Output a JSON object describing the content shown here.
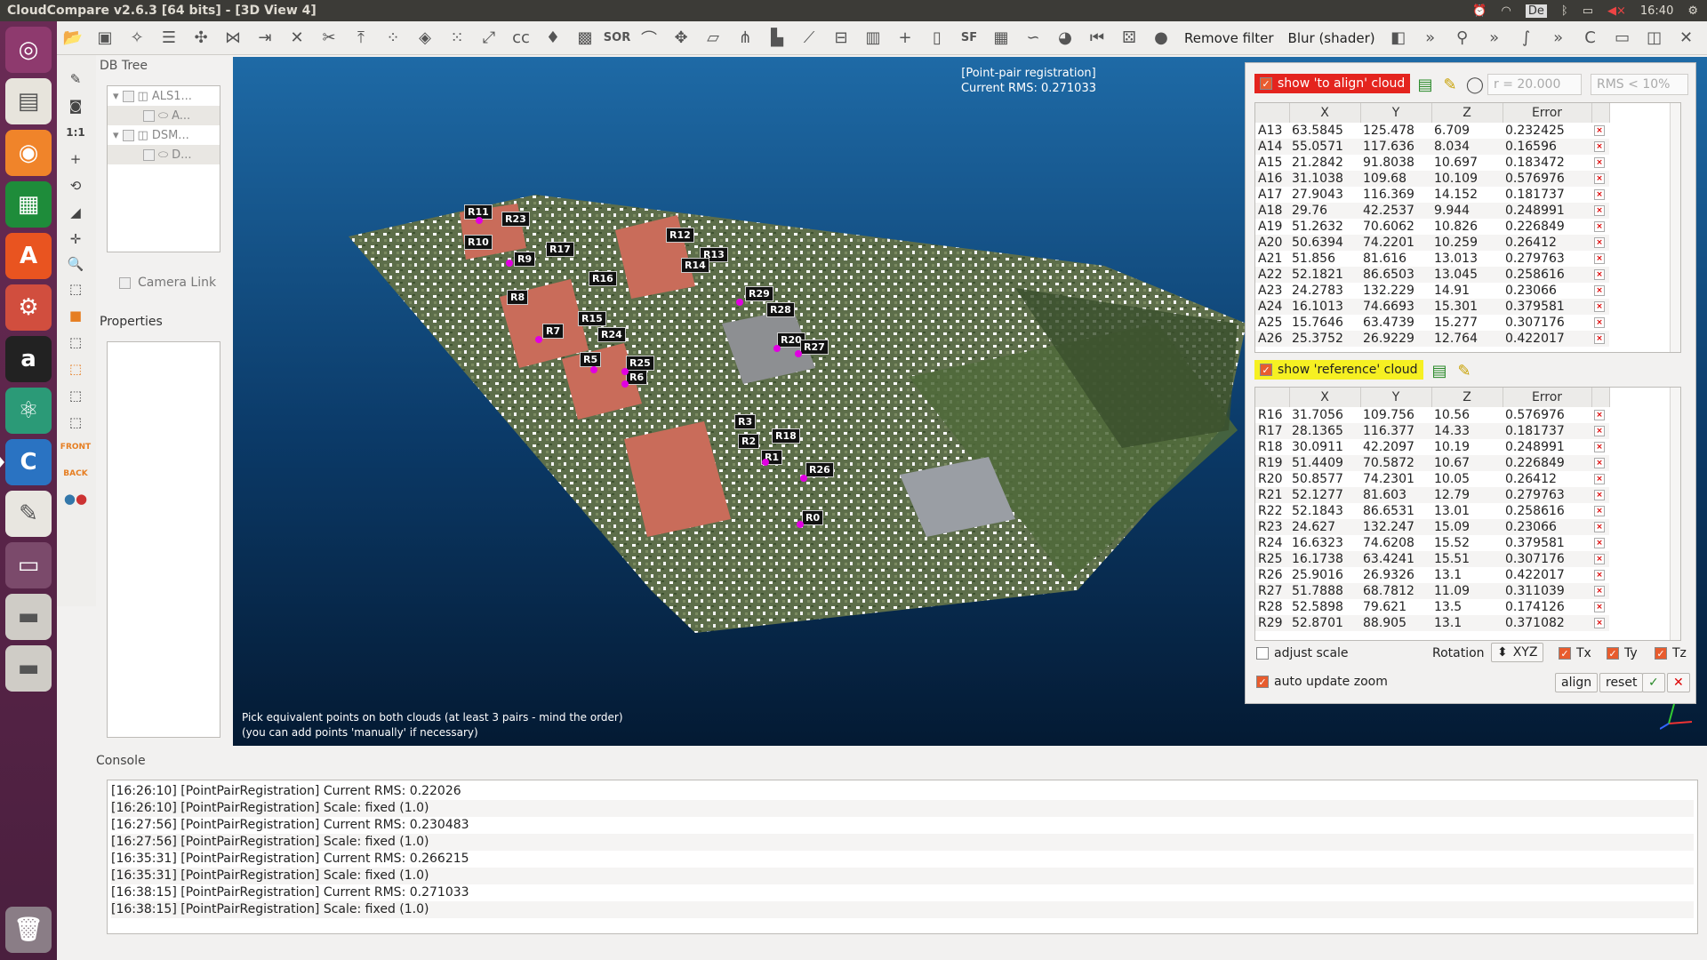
{
  "window": {
    "title": "CloudCompare v2.6.3 [64 bits] - [3D View 4]"
  },
  "system": {
    "keyboard": "De",
    "time": "16:40"
  },
  "toolbar": {
    "remove_filter": "Remove filter",
    "blur_shader": "Blur (shader)",
    "sor_label": "SOR",
    "sf_label": "SF"
  },
  "dbtree": {
    "header": "DB Tree",
    "items": [
      {
        "label": "ALS1..."
      },
      {
        "label": "A..."
      },
      {
        "label": "DSM..."
      },
      {
        "label": "D..."
      }
    ],
    "camera_link": "Camera Link"
  },
  "properties": {
    "header": "Properties"
  },
  "view": {
    "title_line1": "[Point-pair registration]",
    "title_line2": "Current RMS: 0.271033",
    "hint_line1": "Pick equivalent points on both clouds (at least 3 pairs - mind the order)",
    "hint_line2": "(you can add points 'manually' if necessary)",
    "labels": [
      "R11",
      "R23",
      "R10",
      "R9",
      "R17",
      "R12",
      "R13",
      "R14",
      "R16",
      "R8",
      "R29",
      "R28",
      "R15",
      "R7",
      "R24",
      "R20",
      "R27",
      "R5",
      "R25",
      "R6",
      "R3",
      "R18",
      "R2",
      "R1",
      "R26",
      "R0"
    ]
  },
  "registration": {
    "align_toggle": "show 'to align' cloud",
    "radius_placeholder": "r = 20.000",
    "rms_placeholder": "RMS < 10%",
    "reference_toggle": "show 'reference' cloud",
    "columns": [
      "X",
      "Y",
      "Z",
      "Error"
    ],
    "align_rows": [
      [
        "A13",
        "63.5845",
        "125.478",
        "6.709",
        "0.232425"
      ],
      [
        "A14",
        "55.0571",
        "117.636",
        "8.034",
        "0.16596"
      ],
      [
        "A15",
        "21.2842",
        "91.8038",
        "10.697",
        "0.183472"
      ],
      [
        "A16",
        "31.1038",
        "109.68",
        "10.109",
        "0.576976"
      ],
      [
        "A17",
        "27.9043",
        "116.369",
        "14.152",
        "0.181737"
      ],
      [
        "A18",
        "29.76",
        "42.2537",
        "9.944",
        "0.248991"
      ],
      [
        "A19",
        "51.2632",
        "70.6062",
        "10.826",
        "0.226849"
      ],
      [
        "A20",
        "50.6394",
        "74.2201",
        "10.259",
        "0.26412"
      ],
      [
        "A21",
        "51.856",
        "81.616",
        "13.013",
        "0.279763"
      ],
      [
        "A22",
        "52.1821",
        "86.6503",
        "13.045",
        "0.258616"
      ],
      [
        "A23",
        "24.2783",
        "132.229",
        "14.91",
        "0.23066"
      ],
      [
        "A24",
        "16.1013",
        "74.6693",
        "15.301",
        "0.379581"
      ],
      [
        "A25",
        "15.7646",
        "63.4739",
        "15.277",
        "0.307176"
      ],
      [
        "A26",
        "25.3752",
        "26.9229",
        "12.764",
        "0.422017"
      ]
    ],
    "reference_rows": [
      [
        "R16",
        "31.7056",
        "109.756",
        "10.56",
        "0.576976"
      ],
      [
        "R17",
        "28.1365",
        "116.377",
        "14.33",
        "0.181737"
      ],
      [
        "R18",
        "30.0911",
        "42.2097",
        "10.19",
        "0.248991"
      ],
      [
        "R19",
        "51.4409",
        "70.5872",
        "10.67",
        "0.226849"
      ],
      [
        "R20",
        "50.8577",
        "74.2301",
        "10.05",
        "0.26412"
      ],
      [
        "R21",
        "52.1277",
        "81.603",
        "12.79",
        "0.279763"
      ],
      [
        "R22",
        "52.1843",
        "86.6531",
        "13.01",
        "0.258616"
      ],
      [
        "R23",
        "24.627",
        "132.247",
        "15.09",
        "0.23066"
      ],
      [
        "R24",
        "16.6323",
        "74.6208",
        "15.52",
        "0.379581"
      ],
      [
        "R25",
        "16.1738",
        "63.4241",
        "15.51",
        "0.307176"
      ],
      [
        "R26",
        "25.9016",
        "26.9326",
        "13.1",
        "0.422017"
      ],
      [
        "R27",
        "51.7888",
        "68.7812",
        "11.09",
        "0.311039"
      ],
      [
        "R28",
        "52.5898",
        "79.621",
        "13.5",
        "0.174126"
      ],
      [
        "R29",
        "52.8701",
        "88.905",
        "13.1",
        "0.371082"
      ]
    ],
    "adjust_scale": "adjust scale",
    "rotation_label": "Rotation",
    "rotation_value": "XYZ",
    "tx": "Tx",
    "ty": "Ty",
    "tz": "Tz",
    "auto_update_zoom": "auto update zoom",
    "align_button": "align",
    "reset_button": "reset"
  },
  "console": {
    "header": "Console",
    "lines": [
      "[16:26:10] [PointPairRegistration] Current RMS: 0.22026",
      "[16:26:10] [PointPairRegistration] Scale: fixed (1.0)",
      "[16:27:56] [PointPairRegistration] Current RMS: 0.230483",
      "[16:27:56] [PointPairRegistration] Scale: fixed (1.0)",
      "[16:35:31] [PointPairRegistration] Current RMS: 0.266215",
      "[16:35:31] [PointPairRegistration] Scale: fixed (1.0)",
      "[16:38:15] [PointPairRegistration] Current RMS: 0.271033",
      "[16:38:15] [PointPairRegistration] Scale: fixed (1.0)"
    ]
  }
}
